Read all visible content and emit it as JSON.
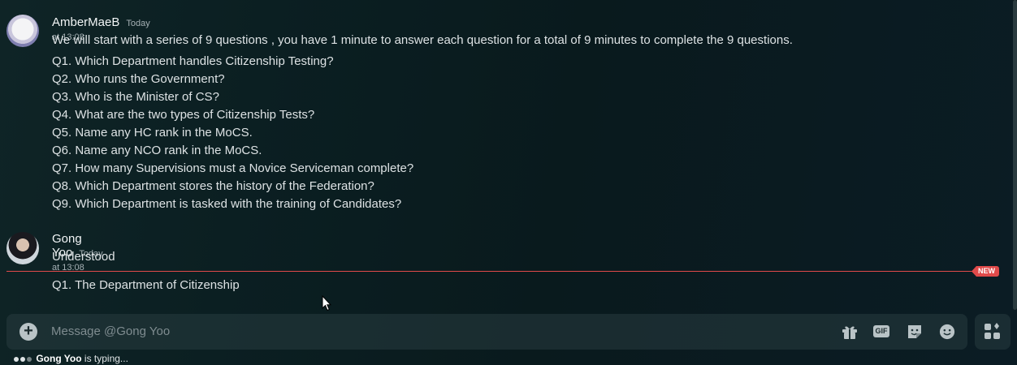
{
  "messages": [
    {
      "author": "AmberMaeB",
      "timestamp": "Today at 13:08",
      "lines": [
        "We will start with a series of 9 questions , you have 1 minute to answer each question for a total of 9 minutes to complete the 9 questions.",
        "Q1. Which Department handles Citizenship Testing?",
        "Q2. Who runs the Government?",
        "Q3. Who is the Minister of CS?",
        "Q4. What are the two types of Citizenship Tests?",
        "Q5. Name any HC rank in the MoCS.",
        "Q6. Name any NCO rank in the MoCS.",
        "Q7. How many Supervisions must a Novice Serviceman complete?",
        "Q8. Which Department stores the history of the Federation?",
        "Q9. Which Department is tasked with the training of Candidates?"
      ]
    },
    {
      "author": "Gong Yoo",
      "timestamp": "Today at 13:08",
      "lines": [
        "Understood"
      ],
      "after_divider": [
        "Q1. The Department of Citizenship"
      ]
    }
  ],
  "new_divider_label": "NEW",
  "composer": {
    "placeholder": "Message @Gong Yoo",
    "gif_label": "GIF",
    "icons": [
      "add-icon",
      "gift-icon",
      "gif-icon",
      "sticker-icon",
      "emoji-icon",
      "apps-icon"
    ]
  },
  "typing": {
    "user": "Gong Yoo",
    "text": "is typing..."
  },
  "colors": {
    "accent_new": "#e04a4a"
  }
}
